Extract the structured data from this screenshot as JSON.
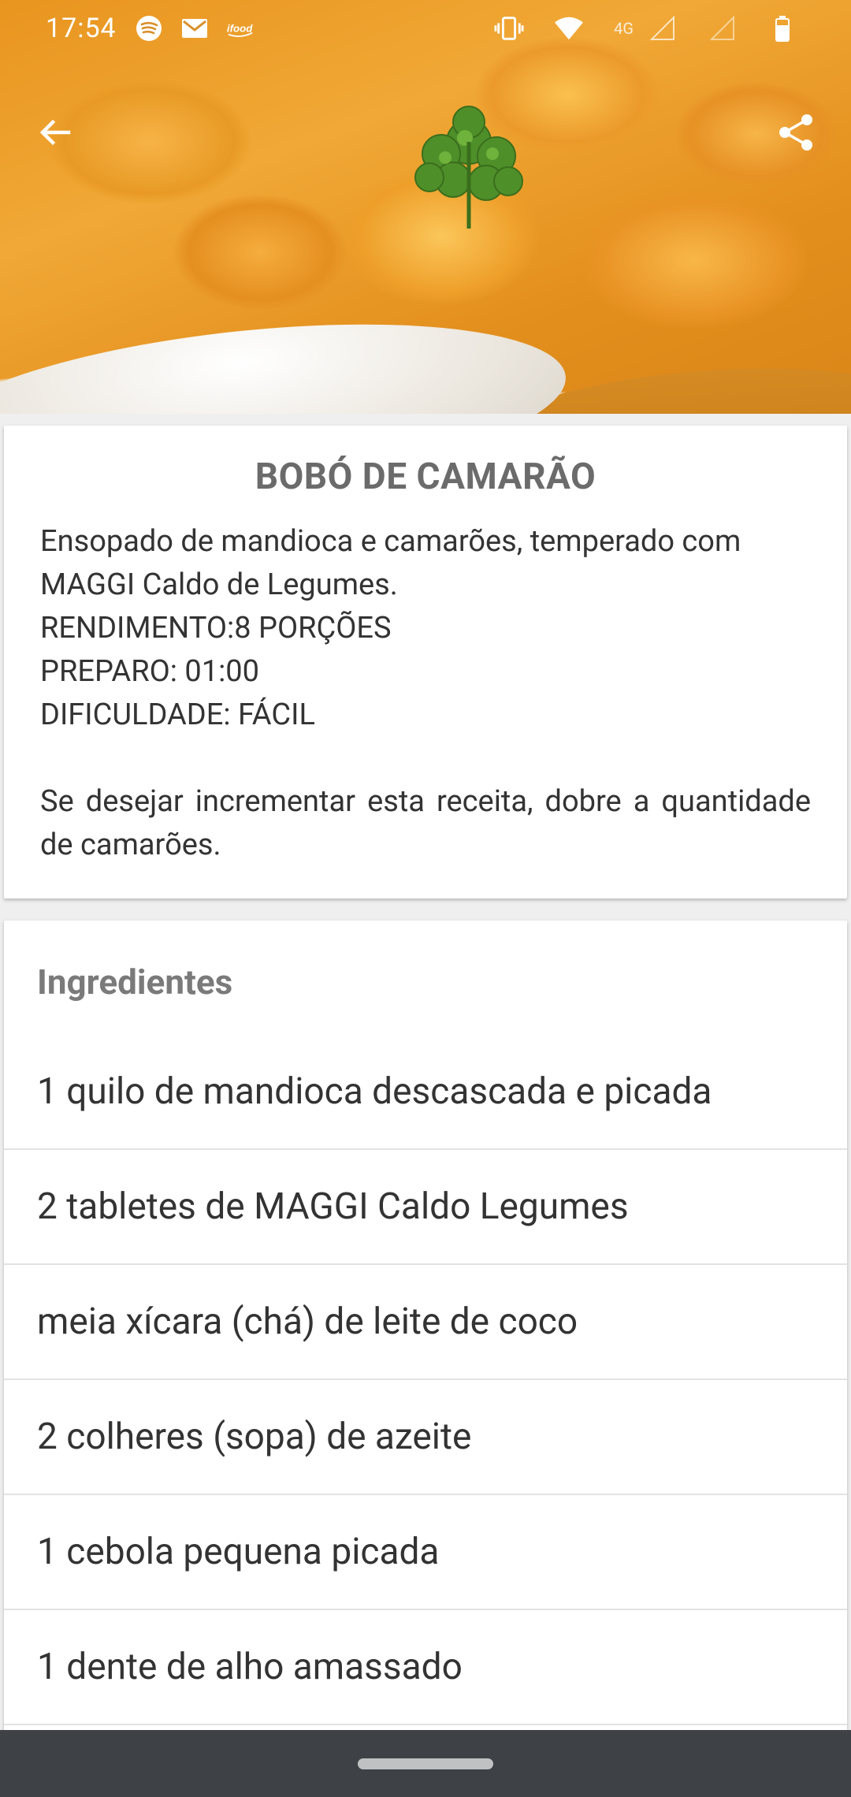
{
  "status_bar": {
    "time": "17:54",
    "network_label": "4G",
    "left_icons": [
      "spotify-icon",
      "gmail-icon",
      "ifood-icon"
    ],
    "right_icons": [
      "vibrate-icon",
      "wifi-icon",
      "signal-icon",
      "signal-empty-icon",
      "battery-icon"
    ]
  },
  "app_bar": {
    "back_icon": "arrow-back-icon",
    "share_icon": "share-icon"
  },
  "recipe": {
    "title": "BOBÓ DE CAMARÃO",
    "description": "Ensopado de mandioca e camarões, temperado com MAGGI Caldo de Legumes.",
    "yield": "RENDIMENTO:8 PORÇÕES",
    "prep": "PREPARO: 01:00",
    "difficulty": "DIFICULDADE: FÁCIL",
    "tip": "Se desejar incrementar esta receita, dobre a quantidade de camarões."
  },
  "ingredients": {
    "header": "Ingredientes",
    "items": [
      "1 quilo de mandioca descascada e picada",
      "2 tabletes de MAGGI Caldo Legumes",
      "meia xícara (chá) de leite de coco",
      "2 colheres (sopa) de azeite",
      "1 cebola pequena picada",
      "1 dente de alho amassado"
    ]
  },
  "colors": {
    "title_gray": "#6b6b6b",
    "text": "#333333",
    "navbar": "#3e4246",
    "background": "#efefef"
  }
}
